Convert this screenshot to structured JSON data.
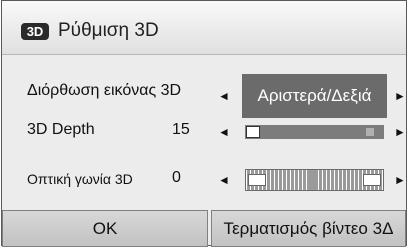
{
  "dialog": {
    "logo_text": "3D",
    "title": "Ρύθμιση 3D"
  },
  "rows": {
    "correction": {
      "label": "Διόρθωση εικόνας 3D",
      "selected": "Αριστερά/Δεξιά"
    },
    "depth": {
      "label": "3D Depth",
      "value": "15"
    },
    "angle": {
      "label": "Οπτική γωνία 3D",
      "value": "0"
    }
  },
  "buttons": {
    "ok": "OK",
    "end_video": "Τερματισμός βίντεο 3Δ"
  },
  "icons": {
    "left": "◄",
    "right": "►"
  }
}
